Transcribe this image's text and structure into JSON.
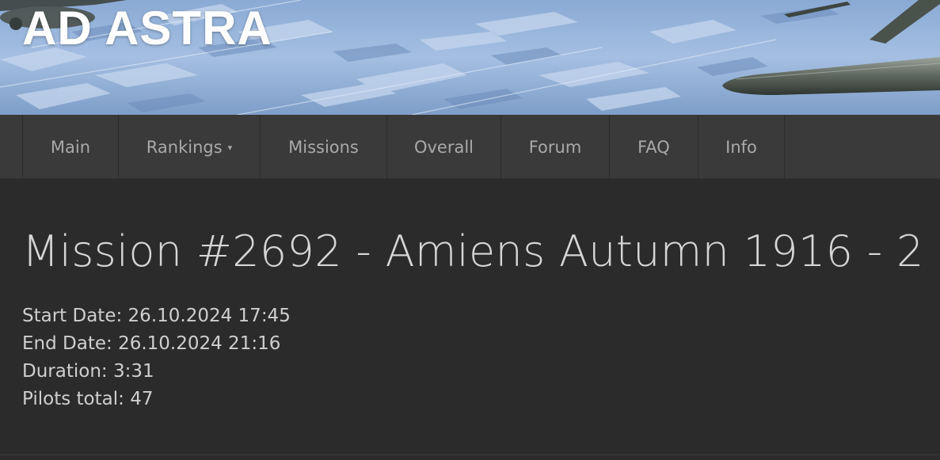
{
  "site": {
    "title": "AD ASTRA"
  },
  "nav": {
    "items": [
      {
        "label": "Main"
      },
      {
        "label": "Rankings",
        "has_dropdown": true,
        "caret": "▾"
      },
      {
        "label": "Missions"
      },
      {
        "label": "Overall"
      },
      {
        "label": "Forum"
      },
      {
        "label": "FAQ"
      },
      {
        "label": "Info"
      }
    ]
  },
  "mission": {
    "title": "Mission #2692 - Amiens Autumn 1916 - 2",
    "start_label": "Start Date:",
    "start_value": "26.10.2024 17:45",
    "end_label": "End Date:",
    "end_value": "26.10.2024 21:16",
    "duration_label": "Duration:",
    "duration_value": "3:31",
    "pilots_label": "Pilots total:",
    "pilots_value": "47"
  },
  "colors": {
    "background": "#2b2b2b",
    "navbar": "#3a3a3a",
    "nav_text": "#a9a9a9",
    "text": "#d4d4d4",
    "banner_sky": "#9ab6dc"
  },
  "icons": {
    "dropdown": "caret-down-icon"
  }
}
